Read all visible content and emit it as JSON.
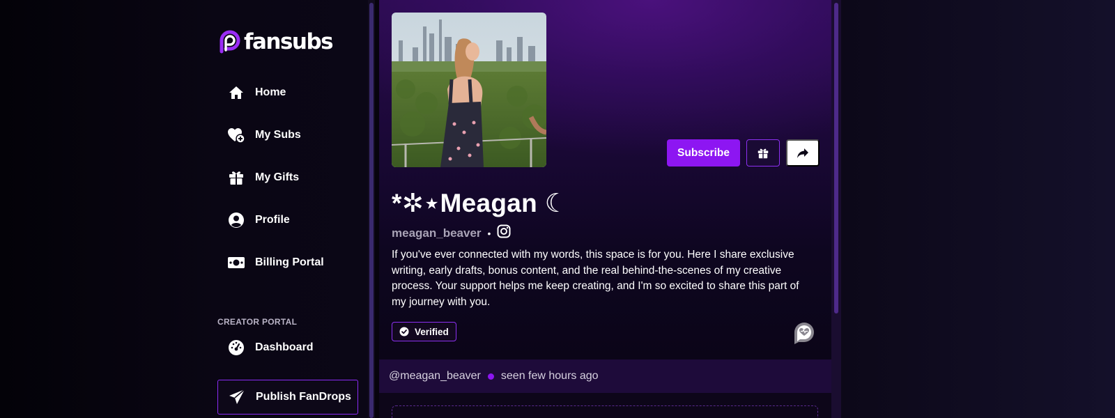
{
  "app": {
    "brand": "fansubs"
  },
  "sidebar": {
    "items": [
      {
        "label": "Home",
        "icon": "home-icon"
      },
      {
        "label": "My Subs",
        "icon": "heart-plus-icon"
      },
      {
        "label": "My Gifts",
        "icon": "gift-icon"
      },
      {
        "label": "Profile",
        "icon": "user-circle-icon"
      },
      {
        "label": "Billing Portal",
        "icon": "money-icon"
      }
    ],
    "creator_section_title": "CREATOR PORTAL",
    "creator_items": [
      {
        "label": "Dashboard",
        "icon": "gauge-icon"
      },
      {
        "label": "Publish FanDrops",
        "icon": "paper-plane-icon"
      }
    ]
  },
  "profile": {
    "display_name": "*✲⋆Meagan ☾",
    "username": "meagan_beaver",
    "separator": "•",
    "social": "instagram-icon",
    "bio": "If you've ever connected with my words, this space is for you. Here I share exclusive writing, early drafts, bonus content, and the real behind-the-scenes of my creative process. Your support helps me keep creating, and I'm so excited to share this part of my journey with you.",
    "badge": "Verified",
    "buttons": {
      "subscribe": "Subscribe",
      "gift": "gift-icon",
      "share": "share-icon"
    }
  },
  "presence": {
    "handle": "@meagan_beaver",
    "status": "seen few hours ago"
  },
  "colors": {
    "accent": "#8d16f2",
    "background": "#07040d",
    "hero_gradient_top": "#4a117c",
    "muted_text": "#a9a3b6"
  }
}
